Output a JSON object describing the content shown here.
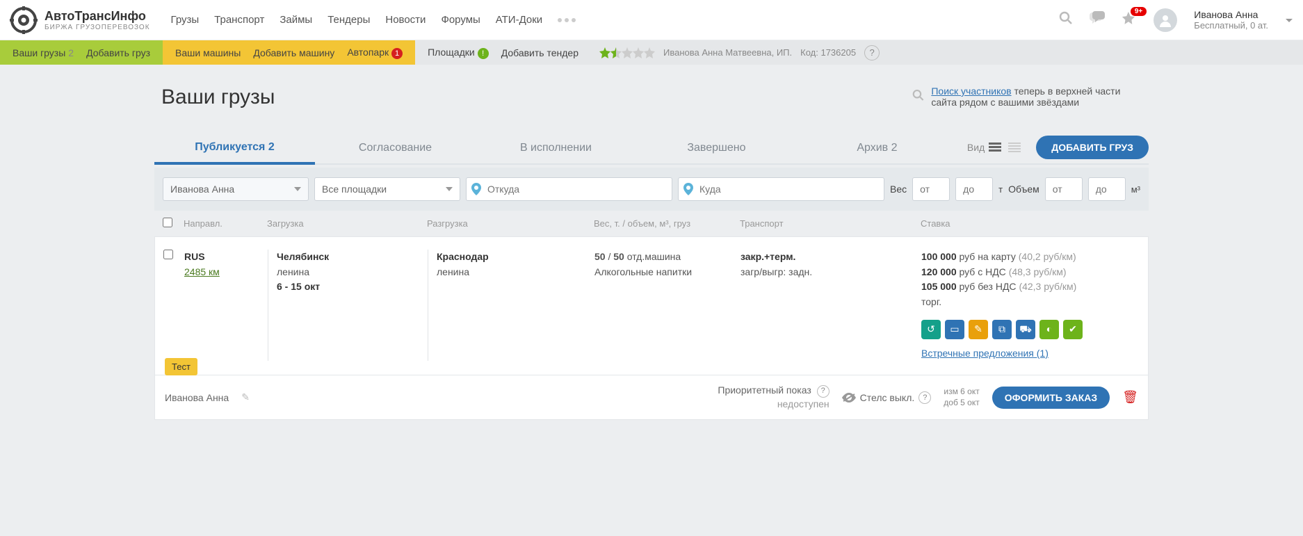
{
  "header": {
    "logo_title": "АвтоТрансИнфо",
    "logo_sub": "БИРЖА ГРУЗОПЕРЕВОЗОК",
    "nav": [
      "Грузы",
      "Транспорт",
      "Займы",
      "Тендеры",
      "Новости",
      "Форумы",
      "АТИ-Доки"
    ],
    "badge_count": "9+",
    "user_name": "Иванова Анна",
    "user_tier": "Бесплатный, 0 ат."
  },
  "subnav": {
    "your_cargo": "Ваши грузы",
    "your_cargo_count": "2",
    "add_cargo": "Добавить груз",
    "your_vehicles": "Ваши машины",
    "add_vehicle": "Добавить машину",
    "autopark": "Автопарк",
    "autopark_badge": "1",
    "platforms": "Площадки",
    "platforms_badge": "!",
    "add_tender": "Добавить тендер",
    "profile": "Иванова Анна Матвеевна, ИП.",
    "code_label": "Код: 1736205"
  },
  "page": {
    "title": "Ваши грузы",
    "hint_link": "Поиск участников",
    "hint_text": " теперь в верхней части сайта рядом с вашими звёздами"
  },
  "tabs": {
    "publish": "Публикуется 2",
    "agree": "Согласование",
    "inwork": "В исполнении",
    "done": "Завершено",
    "archive": "Архив 2",
    "view": "Вид",
    "add_btn": "ДОБАВИТЬ ГРУЗ"
  },
  "filters": {
    "user": "Иванова Анна",
    "platforms": "Все площадки",
    "from_ph": "Откуда",
    "to_ph": "Куда",
    "weight_lbl": "Вес",
    "from": "от",
    "to": "до",
    "t": "т",
    "vol_lbl": "Объем",
    "m3": "м³"
  },
  "grid_head": {
    "dir": "Направл.",
    "load": "Загрузка",
    "unload": "Разгрузка",
    "weight": "Вес, т. / объем, м³, груз",
    "trans": "Транспорт",
    "rate": "Ставка"
  },
  "cargo": {
    "country": "RUS",
    "distance": "2485 км",
    "load_city": "Челябинск",
    "load_street": "ленина",
    "load_dates": "6 - 15 окт",
    "unload_city": "Краснодар",
    "unload_street": "ленина",
    "weight_a": "50",
    "weight_b": "50",
    "weight_tail": "отд.машина",
    "cargo_type": "Алкогольные напитки",
    "trans_type": "закр.+терм.",
    "trans_tail": "загр/выгр: задн.",
    "rate1_b": "100 000",
    "rate1_t": " руб на карту ",
    "rate1_m": "(40,2 руб/км)",
    "rate2_b": "120 000",
    "rate2_t": " руб с НДС ",
    "rate2_m": "(48,3 руб/км)",
    "rate3_b": "105 000",
    "rate3_t": " руб без НДС ",
    "rate3_m": "(42,3 руб/км)",
    "bargain": "торг.",
    "counter_link": "Встречные предложения (1)"
  },
  "footer": {
    "test": "Тест",
    "owner": "Иванова Анна",
    "priority_label": "Приоритетный показ",
    "priority_val": "недоступен",
    "stealth": "Стелс выкл.",
    "date_chg": "изм 6 окт",
    "date_add": "доб 5 окт",
    "order_btn": "ОФОРМИТЬ ЗАКАЗ"
  }
}
